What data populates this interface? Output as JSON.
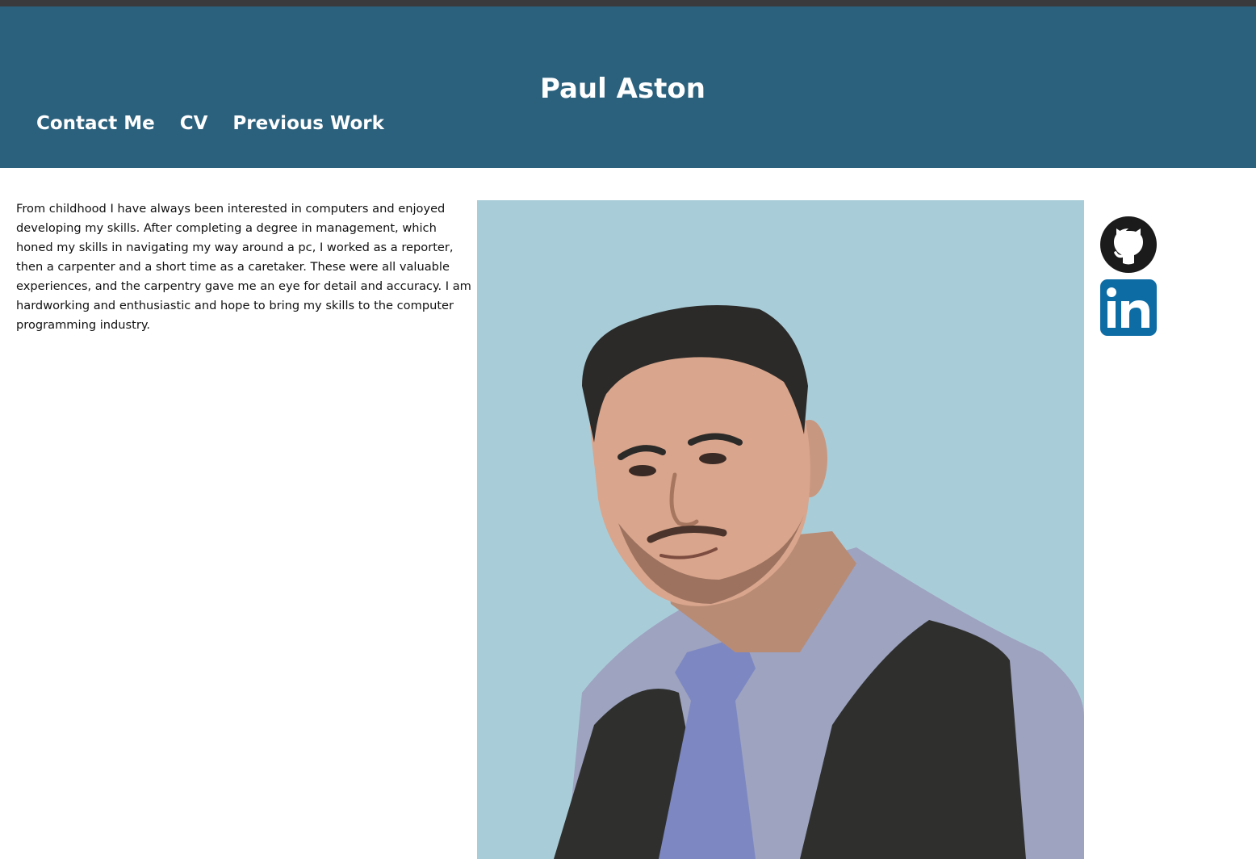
{
  "header": {
    "title": "Paul Aston",
    "nav": [
      {
        "label": "Contact Me"
      },
      {
        "label": "CV"
      },
      {
        "label": "Previous Work"
      }
    ]
  },
  "main": {
    "bio": "From childhood I have always been interested in computers and enjoyed developing my skills. After completing a degree in management, which honed my skills in navigating my way around a pc, I worked as a reporter, then a carpenter and a short time as a caretaker. These were all valuable experiences, and the carpentry gave me an eye for detail and accuracy. I am hardworking and enthusiastic and hope to bring my skills to the computer programming industry."
  },
  "social": {
    "links": [
      {
        "icon": "github-icon"
      },
      {
        "icon": "linkedin-icon"
      }
    ]
  },
  "colors": {
    "header_bg": "#2b617d",
    "top_strip": "#3a3a3c",
    "photo_bg": "#a9cdd8",
    "linkedin_blue": "#0e6ca5"
  }
}
